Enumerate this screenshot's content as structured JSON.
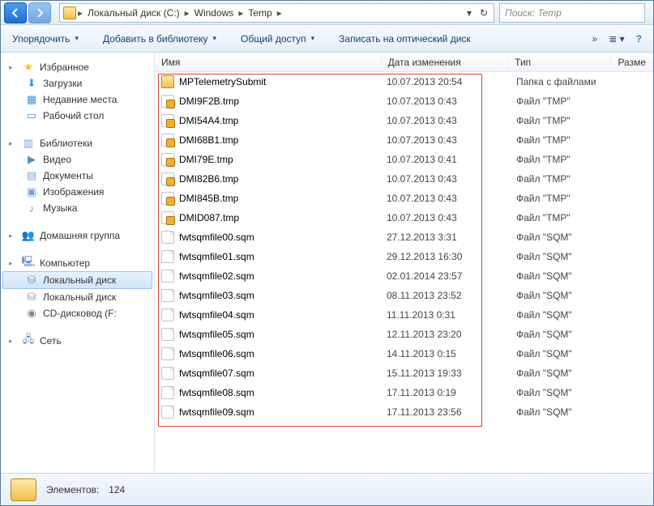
{
  "breadcrumbs": [
    "Локальный диск (C:)",
    "Windows",
    "Temp"
  ],
  "search_placeholder": "Поиск: Temp",
  "toolbar": {
    "organize": "Упорядочить",
    "add_lib": "Добавить в библиотеку",
    "share": "Общий доступ",
    "burn": "Записать на оптический диск"
  },
  "sidebar": {
    "favorites": {
      "label": "Избранное",
      "items": [
        "Загрузки",
        "Недавние места",
        "Рабочий стол"
      ]
    },
    "libraries": {
      "label": "Библиотеки",
      "items": [
        "Видео",
        "Документы",
        "Изображения",
        "Музыка"
      ]
    },
    "homegroup": {
      "label": "Домашняя группа"
    },
    "computer": {
      "label": "Компьютер",
      "items": [
        "Локальный диск",
        "Локальный диск",
        "CD-дисковод (F:"
      ]
    },
    "network": {
      "label": "Сеть"
    }
  },
  "columns": {
    "name": "Имя",
    "date": "Дата изменения",
    "type": "Тип",
    "size": "Разме"
  },
  "files": [
    {
      "icon": "folder",
      "name": "MPTelemetrySubmit",
      "date": "10.07.2013 20:54",
      "type": "Папка с файлами"
    },
    {
      "icon": "lock",
      "name": "DMI9F2B.tmp",
      "date": "10.07.2013 0:43",
      "type": "Файл \"TMP\""
    },
    {
      "icon": "lock",
      "name": "DMI54A4.tmp",
      "date": "10.07.2013 0:43",
      "type": "Файл \"TMP\""
    },
    {
      "icon": "lock",
      "name": "DMI68B1.tmp",
      "date": "10.07.2013 0:43",
      "type": "Файл \"TMP\""
    },
    {
      "icon": "lock",
      "name": "DMI79E.tmp",
      "date": "10.07.2013 0:41",
      "type": "Файл \"TMP\""
    },
    {
      "icon": "lock",
      "name": "DMI82B6.tmp",
      "date": "10.07.2013 0:43",
      "type": "Файл \"TMP\""
    },
    {
      "icon": "lock",
      "name": "DMI845B.tmp",
      "date": "10.07.2013 0:43",
      "type": "Файл \"TMP\""
    },
    {
      "icon": "lock",
      "name": "DMID087.tmp",
      "date": "10.07.2013 0:43",
      "type": "Файл \"TMP\""
    },
    {
      "icon": "blank",
      "name": "fwtsqmfile00.sqm",
      "date": "27.12.2013 3:31",
      "type": "Файл \"SQM\""
    },
    {
      "icon": "blank",
      "name": "fwtsqmfile01.sqm",
      "date": "29.12.2013 16:30",
      "type": "Файл \"SQM\""
    },
    {
      "icon": "blank",
      "name": "fwtsqmfile02.sqm",
      "date": "02.01.2014 23:57",
      "type": "Файл \"SQM\""
    },
    {
      "icon": "blank",
      "name": "fwtsqmfile03.sqm",
      "date": "08.11.2013 23:52",
      "type": "Файл \"SQM\""
    },
    {
      "icon": "blank",
      "name": "fwtsqmfile04.sqm",
      "date": "11.11.2013 0:31",
      "type": "Файл \"SQM\""
    },
    {
      "icon": "blank",
      "name": "fwtsqmfile05.sqm",
      "date": "12.11.2013 23:20",
      "type": "Файл \"SQM\""
    },
    {
      "icon": "blank",
      "name": "fwtsqmfile06.sqm",
      "date": "14.11.2013 0:15",
      "type": "Файл \"SQM\""
    },
    {
      "icon": "blank",
      "name": "fwtsqmfile07.sqm",
      "date": "15.11.2013 19:33",
      "type": "Файл \"SQM\""
    },
    {
      "icon": "blank",
      "name": "fwtsqmfile08.sqm",
      "date": "17.11.2013 0:19",
      "type": "Файл \"SQM\""
    },
    {
      "icon": "blank",
      "name": "fwtsqmfile09.sqm",
      "date": "17.11.2013 23:56",
      "type": "Файл \"SQM\""
    }
  ],
  "status": {
    "count_label": "Элементов:",
    "count": "124"
  }
}
